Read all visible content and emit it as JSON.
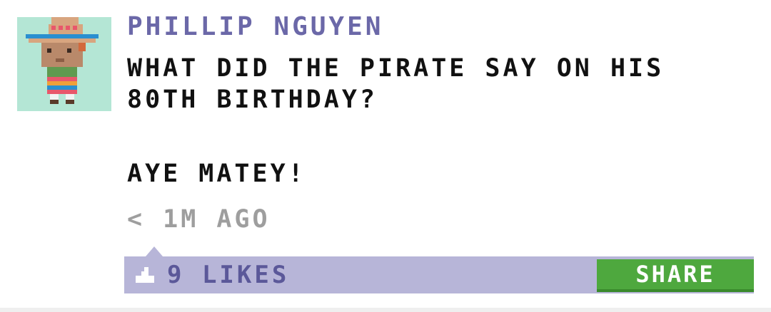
{
  "post": {
    "author": "PHILLIP NGUYEN",
    "message_lines": [
      "WHAT DID THE PIRATE SAY ON HIS",
      "80TH BIRTHDAY?"
    ],
    "punchline": "AYE MATEY!",
    "timestamp": "< 1M AGO"
  },
  "actions": {
    "likes": "9 LIKES",
    "share_label": "SHARE"
  },
  "colors": {
    "author": "#6b68a8",
    "action_bar": "#b7b5d8",
    "share_button": "#4ea83e",
    "avatar_background": "#b4e6d5"
  },
  "icons": {
    "avatar": "sombrero-character-avatar",
    "like": "thumbs-up-icon"
  }
}
